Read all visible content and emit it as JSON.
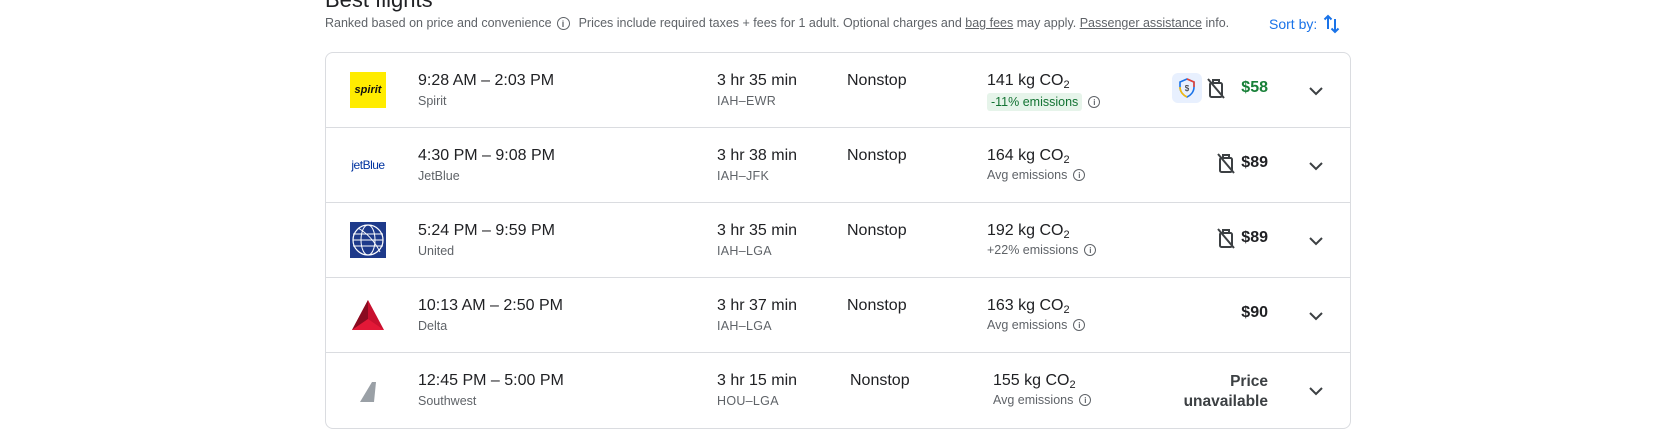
{
  "section": {
    "title": "Best flights",
    "ranked": "Ranked based on price and convenience",
    "prices_pre": "Prices include required taxes + fees for 1 adult. Optional charges and",
    "bag_fees": "bag fees",
    "may_apply": "may apply.",
    "passenger_assistance": "Passenger assistance",
    "info": "info.",
    "sort_by": "Sort by:"
  },
  "flights": [
    {
      "times": "9:28 AM – 2:03 PM",
      "airline": "Spirit",
      "duration": "3 hr 35 min",
      "route": "IAH–EWR",
      "stops": "Nonstop",
      "co2": "141 kg CO",
      "co2_sub": "2",
      "emissions": "-11% emissions",
      "price": "$58",
      "logo": "spirit",
      "logo_text": "spirit"
    },
    {
      "times": "4:30 PM – 9:08 PM",
      "airline": "JetBlue",
      "duration": "3 hr 38 min",
      "route": "IAH–JFK",
      "stops": "Nonstop",
      "co2": "164 kg CO",
      "co2_sub": "2",
      "emissions": "Avg emissions",
      "price": "$89",
      "logo": "jetblue",
      "logo_text": "jetBlue"
    },
    {
      "times": "5:24 PM – 9:59 PM",
      "airline": "United",
      "duration": "3 hr 35 min",
      "route": "IAH–LGA",
      "stops": "Nonstop",
      "co2": "192 kg CO",
      "co2_sub": "2",
      "emissions": "+22% emissions",
      "price": "$89",
      "logo": "united"
    },
    {
      "times": "10:13 AM – 2:50 PM",
      "airline": "Delta",
      "duration": "3 hr 37 min",
      "route": "IAH–LGA",
      "stops": "Nonstop",
      "co2": "163 kg CO",
      "co2_sub": "2",
      "emissions": "Avg emissions",
      "price": "$90",
      "logo": "delta"
    },
    {
      "times": "12:45 PM – 5:00 PM",
      "airline": "Southwest",
      "duration": "3 hr 15 min",
      "route": "HOU–LGA",
      "stops": "Nonstop",
      "co2": "155 kg CO",
      "co2_sub": "2",
      "emissions": "Avg emissions",
      "price_line1": "Price",
      "price_line2": "unavailable",
      "logo": "southwest"
    }
  ],
  "colors": {
    "accent": "#1a73e8",
    "deal": "#188038",
    "low_emissions_bg": "#e6f4ea",
    "spirit": "#ffec00",
    "jetblue": "#0033a0",
    "united": "#1e3a8a",
    "delta": "#c8102e"
  }
}
